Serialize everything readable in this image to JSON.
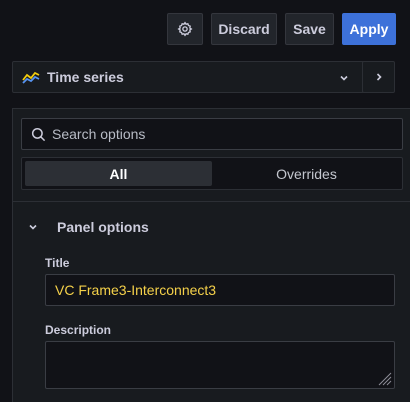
{
  "toolbar": {
    "settings_icon": "gear-icon",
    "discard_label": "Discard",
    "save_label": "Save",
    "apply_label": "Apply"
  },
  "visualization": {
    "icon": "time-series-icon",
    "name": "Time series",
    "dropdown_icon": "chevron-down-icon",
    "collapse_icon": "chevron-right-icon"
  },
  "options": {
    "search": {
      "icon": "search-icon",
      "placeholder": "Search options",
      "value": ""
    },
    "tabs": [
      {
        "label": "All",
        "active": true
      },
      {
        "label": "Overrides",
        "active": false
      }
    ],
    "section": {
      "icon": "chevron-down-icon",
      "title": "Panel options"
    },
    "title_field": {
      "label": "Title",
      "value": "VC Frame3-Interconnect3"
    },
    "description_field": {
      "label": "Description",
      "value": ""
    }
  },
  "colors": {
    "background": "#111217",
    "panel": "#181b1f",
    "border": "#2c2f35",
    "primary": "#3d71d9",
    "title_text": "#f5d14a"
  }
}
